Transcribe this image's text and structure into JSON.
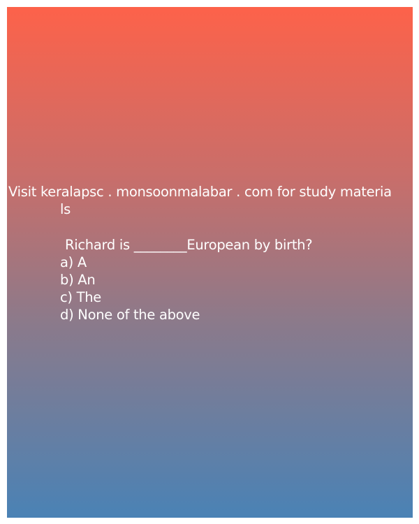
{
  "promo": {
    "line1": "Visit keralapsc . monsoonmalabar . com for study materia",
    "line2": "ls"
  },
  "question": {
    "text": "Richard is ________European by birth?",
    "options": [
      "a) A",
      "b) An",
      "c) The",
      "d) None of the above"
    ]
  },
  "colors": {
    "gradient_top": "#fd624a",
    "gradient_bottom": "#4a82b5",
    "text": "#ffffff"
  }
}
